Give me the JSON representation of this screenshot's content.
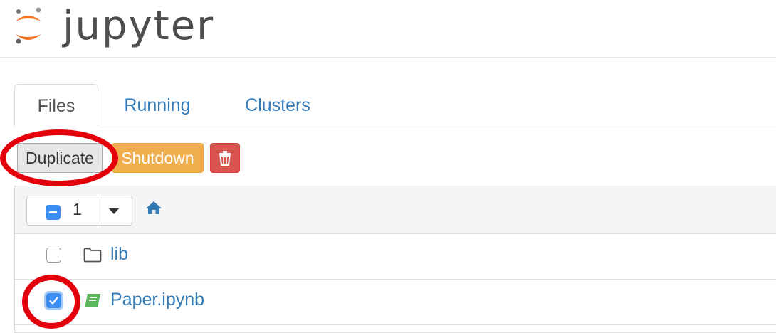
{
  "header": {
    "logo_text": "jupyter"
  },
  "tabs": [
    {
      "label": "Files"
    },
    {
      "label": "Running"
    },
    {
      "label": "Clusters"
    }
  ],
  "toolbar": {
    "duplicate_label": "Duplicate",
    "shutdown_label": "Shutdown",
    "delete_icon": "trash-icon"
  },
  "list_header": {
    "selected_count": "1",
    "home_icon": "home-icon"
  },
  "files": [
    {
      "name": "lib",
      "icon": "folder-icon",
      "checked": false
    },
    {
      "name": "Paper.ipynb",
      "icon": "notebook-icon",
      "checked": true
    }
  ],
  "colors": {
    "link": "#337ab7",
    "warning": "#f0ad4e",
    "danger": "#d9534f",
    "checkbox": "#3d8ef2",
    "annotation": "#e3000b",
    "logo_orange": "#f37726"
  }
}
